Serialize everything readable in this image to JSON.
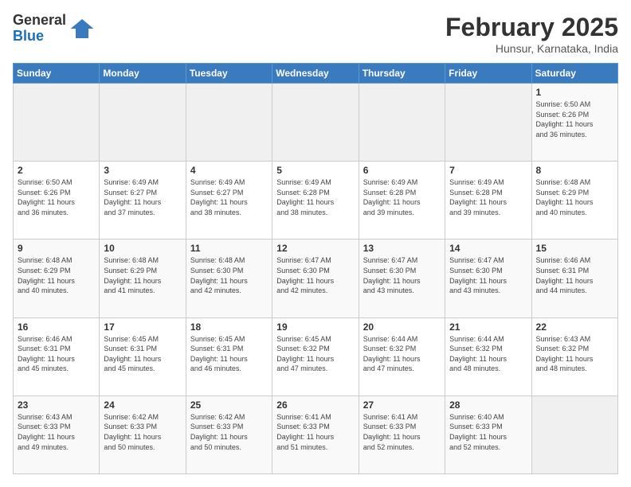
{
  "header": {
    "logo_line1": "General",
    "logo_line2": "Blue",
    "month": "February 2025",
    "location": "Hunsur, Karnataka, India"
  },
  "weekdays": [
    "Sunday",
    "Monday",
    "Tuesday",
    "Wednesday",
    "Thursday",
    "Friday",
    "Saturday"
  ],
  "weeks": [
    [
      {
        "day": "",
        "info": ""
      },
      {
        "day": "",
        "info": ""
      },
      {
        "day": "",
        "info": ""
      },
      {
        "day": "",
        "info": ""
      },
      {
        "day": "",
        "info": ""
      },
      {
        "day": "",
        "info": ""
      },
      {
        "day": "1",
        "info": "Sunrise: 6:50 AM\nSunset: 6:26 PM\nDaylight: 11 hours\nand 36 minutes."
      }
    ],
    [
      {
        "day": "2",
        "info": "Sunrise: 6:50 AM\nSunset: 6:26 PM\nDaylight: 11 hours\nand 36 minutes."
      },
      {
        "day": "3",
        "info": "Sunrise: 6:49 AM\nSunset: 6:27 PM\nDaylight: 11 hours\nand 37 minutes."
      },
      {
        "day": "4",
        "info": "Sunrise: 6:49 AM\nSunset: 6:27 PM\nDaylight: 11 hours\nand 38 minutes."
      },
      {
        "day": "5",
        "info": "Sunrise: 6:49 AM\nSunset: 6:28 PM\nDaylight: 11 hours\nand 38 minutes."
      },
      {
        "day": "6",
        "info": "Sunrise: 6:49 AM\nSunset: 6:28 PM\nDaylight: 11 hours\nand 39 minutes."
      },
      {
        "day": "7",
        "info": "Sunrise: 6:49 AM\nSunset: 6:28 PM\nDaylight: 11 hours\nand 39 minutes."
      },
      {
        "day": "8",
        "info": "Sunrise: 6:48 AM\nSunset: 6:29 PM\nDaylight: 11 hours\nand 40 minutes."
      }
    ],
    [
      {
        "day": "9",
        "info": "Sunrise: 6:48 AM\nSunset: 6:29 PM\nDaylight: 11 hours\nand 40 minutes."
      },
      {
        "day": "10",
        "info": "Sunrise: 6:48 AM\nSunset: 6:29 PM\nDaylight: 11 hours\nand 41 minutes."
      },
      {
        "day": "11",
        "info": "Sunrise: 6:48 AM\nSunset: 6:30 PM\nDaylight: 11 hours\nand 42 minutes."
      },
      {
        "day": "12",
        "info": "Sunrise: 6:47 AM\nSunset: 6:30 PM\nDaylight: 11 hours\nand 42 minutes."
      },
      {
        "day": "13",
        "info": "Sunrise: 6:47 AM\nSunset: 6:30 PM\nDaylight: 11 hours\nand 43 minutes."
      },
      {
        "day": "14",
        "info": "Sunrise: 6:47 AM\nSunset: 6:30 PM\nDaylight: 11 hours\nand 43 minutes."
      },
      {
        "day": "15",
        "info": "Sunrise: 6:46 AM\nSunset: 6:31 PM\nDaylight: 11 hours\nand 44 minutes."
      }
    ],
    [
      {
        "day": "16",
        "info": "Sunrise: 6:46 AM\nSunset: 6:31 PM\nDaylight: 11 hours\nand 45 minutes."
      },
      {
        "day": "17",
        "info": "Sunrise: 6:45 AM\nSunset: 6:31 PM\nDaylight: 11 hours\nand 45 minutes."
      },
      {
        "day": "18",
        "info": "Sunrise: 6:45 AM\nSunset: 6:31 PM\nDaylight: 11 hours\nand 46 minutes."
      },
      {
        "day": "19",
        "info": "Sunrise: 6:45 AM\nSunset: 6:32 PM\nDaylight: 11 hours\nand 47 minutes."
      },
      {
        "day": "20",
        "info": "Sunrise: 6:44 AM\nSunset: 6:32 PM\nDaylight: 11 hours\nand 47 minutes."
      },
      {
        "day": "21",
        "info": "Sunrise: 6:44 AM\nSunset: 6:32 PM\nDaylight: 11 hours\nand 48 minutes."
      },
      {
        "day": "22",
        "info": "Sunrise: 6:43 AM\nSunset: 6:32 PM\nDaylight: 11 hours\nand 48 minutes."
      }
    ],
    [
      {
        "day": "23",
        "info": "Sunrise: 6:43 AM\nSunset: 6:33 PM\nDaylight: 11 hours\nand 49 minutes."
      },
      {
        "day": "24",
        "info": "Sunrise: 6:42 AM\nSunset: 6:33 PM\nDaylight: 11 hours\nand 50 minutes."
      },
      {
        "day": "25",
        "info": "Sunrise: 6:42 AM\nSunset: 6:33 PM\nDaylight: 11 hours\nand 50 minutes."
      },
      {
        "day": "26",
        "info": "Sunrise: 6:41 AM\nSunset: 6:33 PM\nDaylight: 11 hours\nand 51 minutes."
      },
      {
        "day": "27",
        "info": "Sunrise: 6:41 AM\nSunset: 6:33 PM\nDaylight: 11 hours\nand 52 minutes."
      },
      {
        "day": "28",
        "info": "Sunrise: 6:40 AM\nSunset: 6:33 PM\nDaylight: 11 hours\nand 52 minutes."
      },
      {
        "day": "",
        "info": ""
      }
    ]
  ]
}
